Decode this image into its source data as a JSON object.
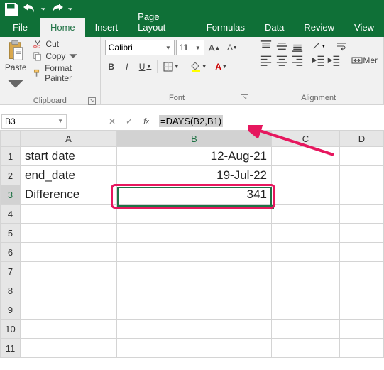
{
  "qat": {
    "save": "save",
    "undo": "undo",
    "redo": "redo"
  },
  "tabs": {
    "file": "File",
    "home": "Home",
    "insert": "Insert",
    "page_layout": "Page Layout",
    "formulas": "Formulas",
    "data": "Data",
    "review": "Review",
    "view": "View"
  },
  "ribbon": {
    "clipboard": {
      "label": "Clipboard",
      "paste": "Paste",
      "cut": "Cut",
      "copy": "Copy",
      "format_painter": "Format Painter"
    },
    "font": {
      "label": "Font",
      "name": "Calibri",
      "size": "11",
      "bold": "B",
      "italic": "I",
      "underline": "U"
    },
    "alignment": {
      "label": "Alignment",
      "merge": "Mer"
    }
  },
  "formula_bar": {
    "name_box": "B3",
    "formula": "=DAYS(B2,B1)"
  },
  "columns": [
    "A",
    "B",
    "C",
    "D"
  ],
  "rows": [
    {
      "n": "1",
      "A": "start date",
      "B": "12-Aug-21"
    },
    {
      "n": "2",
      "A": "end_date",
      "B": "19-Jul-22"
    },
    {
      "n": "3",
      "A": "Difference",
      "B": "341"
    },
    {
      "n": "4",
      "A": "",
      "B": ""
    },
    {
      "n": "5",
      "A": "",
      "B": ""
    },
    {
      "n": "6",
      "A": "",
      "B": ""
    },
    {
      "n": "7",
      "A": "",
      "B": ""
    },
    {
      "n": "8",
      "A": "",
      "B": ""
    },
    {
      "n": "9",
      "A": "",
      "B": ""
    },
    {
      "n": "10",
      "A": "",
      "B": ""
    },
    {
      "n": "11",
      "A": "",
      "B": ""
    }
  ],
  "selected_cell": "B3"
}
